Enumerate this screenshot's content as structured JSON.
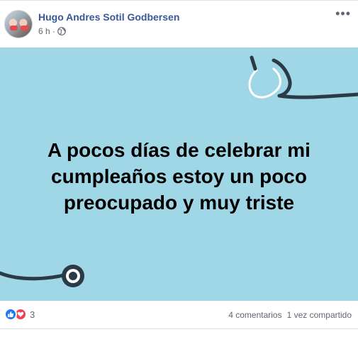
{
  "post": {
    "author": "Hugo Andres Sotil Godbersen",
    "time": "6 h",
    "privacy_icon": "globe-icon",
    "menu_icon": "more-options-icon",
    "more_label": "•••",
    "image_text": "A pocos días de celebrar mi cumpleaños estoy un poco preocupado y muy triste",
    "background_color": "#a0d7e6"
  },
  "footer": {
    "reaction_icons": [
      "like-icon",
      "love-icon"
    ],
    "reaction_count": "3",
    "comments": "4 comentarios",
    "shares": "1 vez compartido"
  }
}
